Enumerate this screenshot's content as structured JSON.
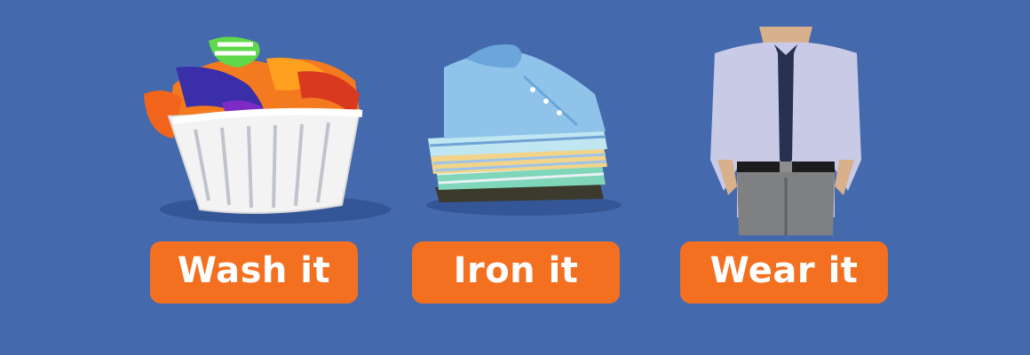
{
  "colors": {
    "background": "#4569ad",
    "button": "#f37021",
    "button_text": "#ffffff"
  },
  "steps": [
    {
      "label": "Wash it",
      "icon": "laundry-basket-icon"
    },
    {
      "label": "Iron it",
      "icon": "folded-shirts-icon"
    },
    {
      "label": "Wear it",
      "icon": "dressed-man-icon"
    }
  ]
}
